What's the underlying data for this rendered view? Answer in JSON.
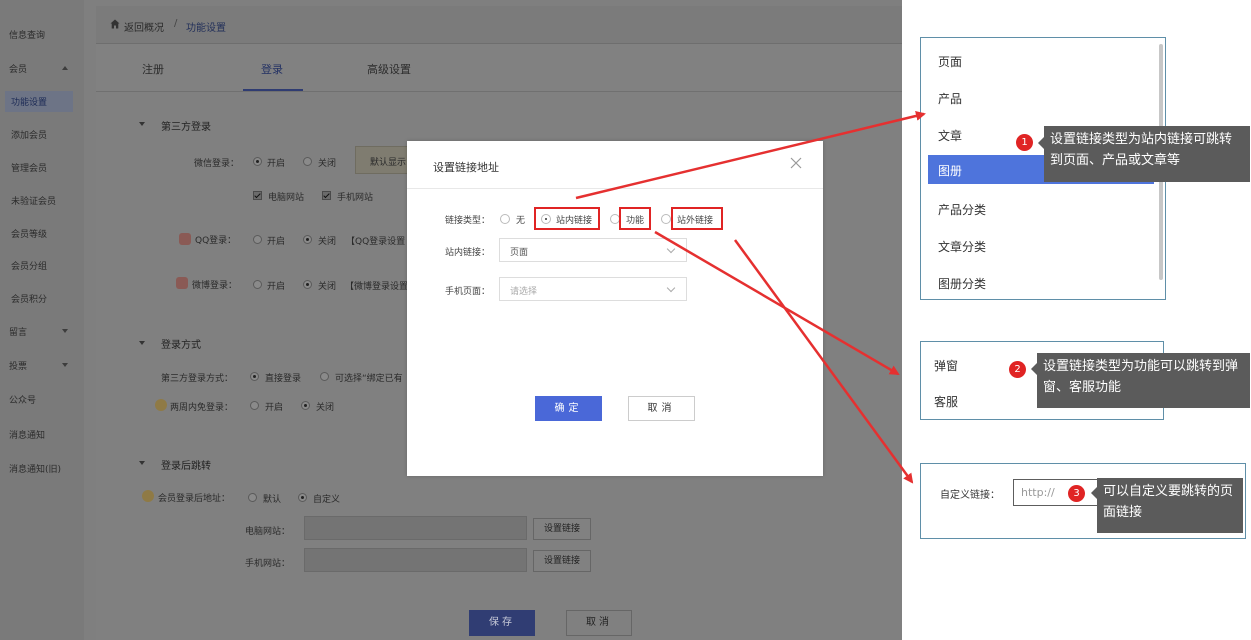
{
  "sidebar": {
    "items": [
      {
        "label": "信息查询"
      },
      {
        "label": "会员"
      },
      {
        "label": "功能设置"
      },
      {
        "label": "添加会员"
      },
      {
        "label": "管理会员"
      },
      {
        "label": "未验证会员"
      },
      {
        "label": "会员等级"
      },
      {
        "label": "会员分组"
      },
      {
        "label": "会员积分"
      },
      {
        "label": "留言"
      },
      {
        "label": "投票"
      },
      {
        "label": "公众号"
      },
      {
        "label": "消息通知"
      },
      {
        "label": "消息通知(旧)"
      }
    ]
  },
  "breadcrumb": {
    "back": "返回概况",
    "separator": "/",
    "current": "功能设置"
  },
  "tabs": [
    {
      "label": "注册"
    },
    {
      "label": "登录"
    },
    {
      "label": "高级设置"
    }
  ],
  "third_party": {
    "title": "第三方登录",
    "wechat": {
      "label": "微信登录：",
      "on": "开启",
      "off": "关闭",
      "pc": "电脑网站",
      "mobile": "手机网站",
      "tip": "默认显示"
    },
    "qq": {
      "label": "QQ登录：",
      "on": "开启",
      "off": "关闭",
      "note": "【QQ登录设置"
    },
    "weibo": {
      "label": "微博登录：",
      "on": "开启",
      "off": "关闭",
      "note": "【微博登录设置"
    }
  },
  "login_method": {
    "title": "登录方式",
    "method": {
      "label": "第三方登录方式：",
      "direct": "直接登录",
      "optional": "可选择“绑定已有"
    },
    "two_week": {
      "label": "两周内免登录：",
      "on": "开启",
      "off": "关闭"
    }
  },
  "after_login": {
    "title": "登录后跳转",
    "address": {
      "label": "会员登录后地址：",
      "default": "默认",
      "custom": "自定义"
    },
    "pc": {
      "label": "电脑网站：",
      "button": "设置链接"
    },
    "mobile": {
      "label": "手机网站：",
      "button": "设置链接"
    }
  },
  "footer": {
    "save": "保存",
    "cancel": "取消"
  },
  "modal": {
    "title": "设置链接地址",
    "link_type_label": "链接类型：",
    "options": {
      "none": "无",
      "internal": "站内链接",
      "function": "功能",
      "external": "站外链接"
    },
    "internal_link_label": "站内链接：",
    "internal_link_value": "页面",
    "mobile_page_label": "手机页面：",
    "mobile_page_placeholder": "请选择",
    "ok": "确定",
    "cancel": "取消"
  },
  "dropdown": {
    "items": [
      "页面",
      "产品",
      "文章"
    ],
    "selected": "图册",
    "items_after": [
      "产品分类",
      "文章分类",
      "图册分类"
    ]
  },
  "function_menu": {
    "items": [
      "弹窗",
      "客服"
    ]
  },
  "custom_link": {
    "label": "自定义链接：",
    "placeholder": "http://"
  },
  "callouts": [
    {
      "num": "1",
      "text": "设置链接类型为站内链接可跳转到页面、产品或文章等"
    },
    {
      "num": "2",
      "text": "设置链接类型为功能可以跳转到弹窗、客服功能"
    },
    {
      "num": "3",
      "text": "可以自定义要跳转的页面链接"
    }
  ],
  "colors": {
    "accent": "#4a68d8",
    "highlight": "#4e74dc",
    "annotation": "#e02424",
    "callout_bg": "#5b5b5b"
  }
}
